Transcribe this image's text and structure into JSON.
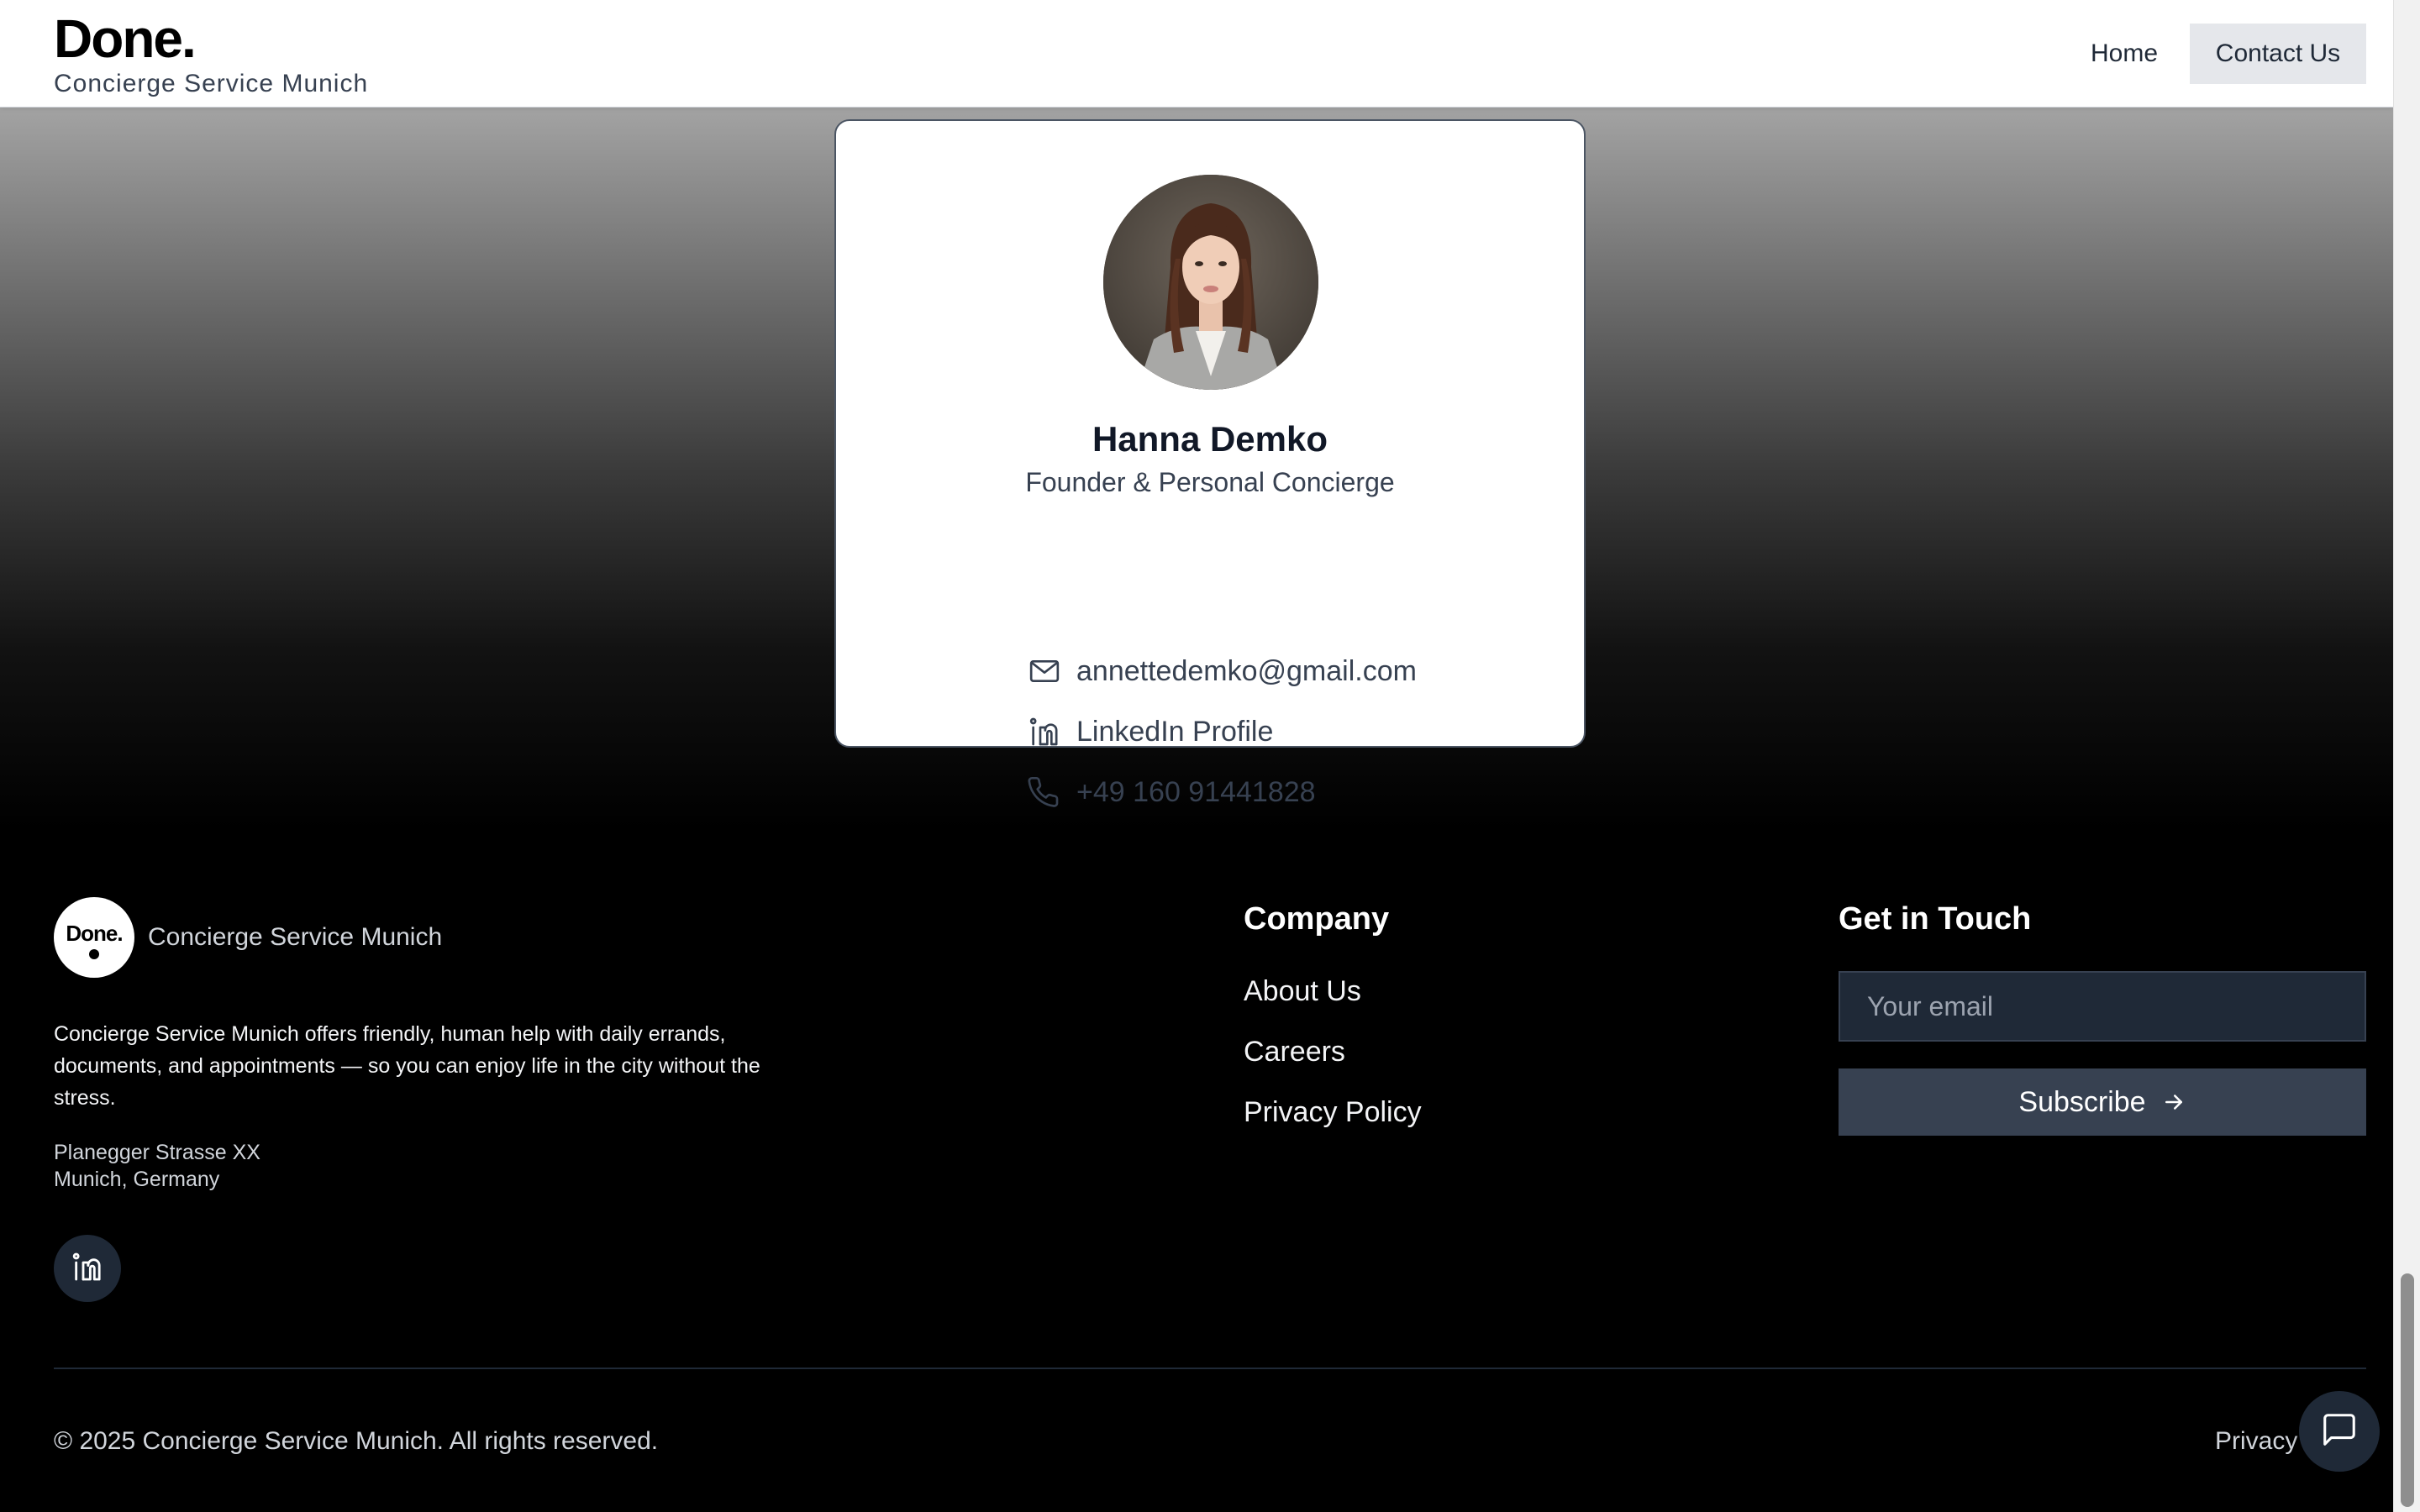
{
  "header": {
    "logo_text": "Done.",
    "tagline": "Concierge Service Munich",
    "nav": {
      "home": "Home",
      "contact": "Contact Us"
    }
  },
  "profile": {
    "name": "Hanna Demko",
    "role": "Founder & Personal Concierge",
    "email": "annettedemko@gmail.com",
    "linkedin": "LinkedIn Profile",
    "phone": "+49 160 91441828",
    "icons": {
      "email": "mail-icon",
      "linkedin": "linkedin-icon",
      "phone": "phone-icon"
    }
  },
  "footer": {
    "logo_text": "Done.",
    "brand_name": "Concierge Service Munich",
    "description": "Concierge Service Munich offers friendly, human help with daily errands, documents, and appointments — so you can enjoy life in the city without the stress.",
    "address_line1": "Planegger Strasse XX",
    "address_line2": "Munich, Germany",
    "company": {
      "title": "Company",
      "links": [
        "About Us",
        "Careers",
        "Privacy Policy"
      ]
    },
    "contact": {
      "title": "Get in Touch",
      "email_placeholder": "Your email",
      "subscribe_label": "Subscribe"
    },
    "copyright": "© 2025 Concierge Service Munich. All rights reserved.",
    "privacy_link": "Privacy"
  },
  "colors": {
    "footer_bg": "#000000",
    "card_bg": "#ffffff",
    "button_bg": "#374151",
    "input_bg": "#1f2937",
    "nav_active_bg": "#e5e7eb"
  }
}
